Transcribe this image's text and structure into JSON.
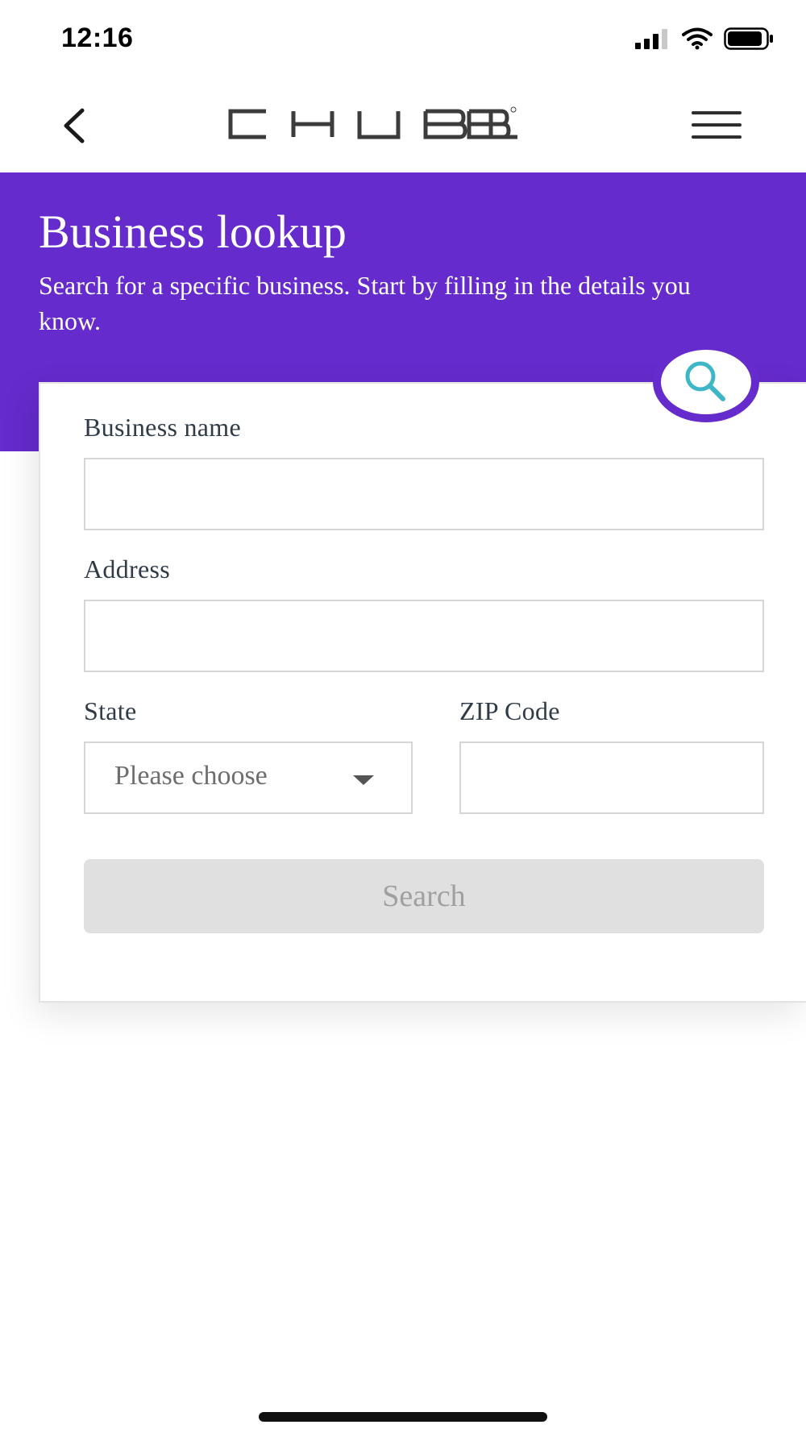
{
  "status_bar": {
    "time": "12:16"
  },
  "nav": {
    "logo_text": "CHUBB",
    "logo_mark": "®",
    "back_icon": "chevron-left-icon",
    "menu_icon": "hamburger-menu-icon"
  },
  "hero": {
    "title": "Business lookup",
    "subtitle": "Search for a specific business. Start by filling in the details you know."
  },
  "form": {
    "business_name": {
      "label": "Business name",
      "value": ""
    },
    "address": {
      "label": "Address",
      "value": ""
    },
    "state": {
      "label": "State",
      "selected": "Please choose"
    },
    "zip": {
      "label": "ZIP Code",
      "value": ""
    },
    "search_label": "Search"
  },
  "colors": {
    "brand_purple": "#652bcc",
    "search_icon_teal": "#3fb6c7",
    "disabled_button": "#e0e0e0"
  }
}
